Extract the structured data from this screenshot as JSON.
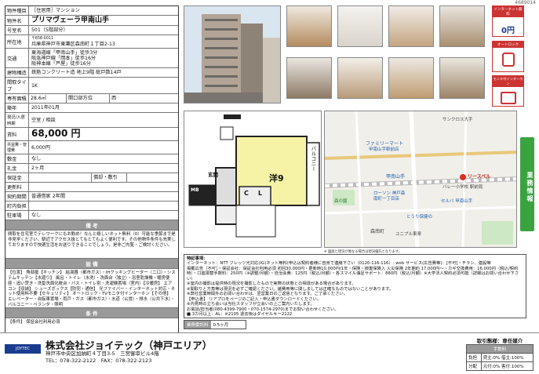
{
  "doc_id": "4689014",
  "property": {
    "rows": {
      "type_label": "物件種目",
      "type_value": "［住居用］マンション",
      "name_label": "物件名",
      "name_value": "プリマヴェーラ甲南山手",
      "room_label": "号室名",
      "room_value": "501（5階部分）",
      "addr_label": "所在地",
      "postal": "〒658-0011",
      "addr_value": "兵庫県神戸市東灘区森南町１丁目2-13",
      "traffic_label": "交通",
      "traffic_1": "東海道線「甲南山手」徒歩3分",
      "traffic_2": "阪急神戸線「岡本」徒歩16分",
      "traffic_3": "阪神本線「芦屋」徒歩16分",
      "structure_label": "建物構造",
      "structure_value": "鉄筋コンクリート造 地上9階 総戸数14戸",
      "layout_label": "間取タイプ",
      "layout_value": "1K",
      "area_label": "専有面積",
      "area_value": "28.6㎡",
      "opening_label": "開口部方位",
      "opening_value": "西",
      "built_label": "築年",
      "built_value": "2011年01月",
      "vacancy_label": "現況/入居時期",
      "vacancy_value": "空室 / 相談",
      "rent_label": "賃料",
      "rent_value": "68,000 円",
      "fee_label": "共益費・管理費",
      "fee_value": "6,000円",
      "deposit_label": "敷金",
      "deposit_value": "なし",
      "key_label": "礼金",
      "key_value": "2ヶ月",
      "guarantee_label": "保証金",
      "guarantee_value": "",
      "amort_label": "償却・敷引",
      "amort_value": "",
      "renewal_label": "更新料",
      "renewal_value": "",
      "contract_label": "契約期間",
      "contract_value": "普通借家 2年間",
      "parking_label": "町内負担",
      "parking_value": "",
      "lot_label": "駐車場",
      "lot_value": "なし"
    },
    "notes_title": "備 考",
    "notes_text": "間取を住宅室でテレワークにもお勧め！なんと嬉しいネット無料（0）可能な季節まで是非見学ください。駅近でアクセス抜とてもとてもよく便利です。その他物件条件も充実しておりますので快適生活をお送りできることでしょう。是非ご内覧・ご検討ください。",
    "equip_title": "設 備",
    "equip_text": "【位置】 角部屋【キッチン】 給湯器（都市ガス）・IHクッキングヒーター（二口）・システムキッチン【水廻り】 風呂・トイレ（水洗）・洗面台（独立）・浴室乾燥機・暖房便座・追い焚き・洗髪洗面化粧台・バス・トイレ別・洗濯機置場（室内）【冷暖房】 エアコン【収納】 シューズボックス【防犯・通信】 光ファイバー・インターネット対応・ネット使用料不要【セキュリティ】 オートロック・TVモニタ付インターホン【その他】 エレベーター・自転車置場・雨戸・ガス（都市ガス）・水道（公営）・排水（公共下水）・バルコニー・ペランダ・照明",
    "cond_title": "条 件",
    "cond_text": "【条件】 保証会社利用必須"
  },
  "icons": {
    "net_label": "インターネット無料",
    "net_value": "0円",
    "lock_label": "オートロック",
    "monitor_label": "モニタ付インターホン"
  },
  "side_tab": "業務情報",
  "plan": {
    "room_label": "洋9",
    "balcony": "バルコニー",
    "entrance": "玄関",
    "ms": "MB",
    "cl": "C",
    "l": "L"
  },
  "map": {
    "labels": [
      "ファミリーマート",
      "甲南山手駅前店",
      "甲南山手",
      "ローソン 神戸森",
      "南町一丁目店",
      "セルバ 甲南山手",
      "とうり保健の",
      "サンクロス大手",
      "ユニプル東楽",
      "森南町",
      "バレー小学校 駅前局",
      "森の園"
    ],
    "pin": "リースペル"
  },
  "caption": "※ 図面と現況が異なる場合は現況優先となります。",
  "remarks": {
    "title": "特記事項：",
    "lines": [
      "インターネット：NTT フレッツ光対応(IG)ネット無料(申込は契約者様に自身で連絡下さい（0120-116-116）- web サービス(広告費等)：[不可]・チラシ、建設等",
      "掲載広告［不可］・保証会社：保証会社利用必須 初回30,000円・更新時10,000円/1年・保険・損害保険入 火災保険 2年期約 17,000円～・カギ交換費用：16,000円（税込/契約時）・口座振替手数料：250円（※調整/月額）・自治会費：125円（税込/月額）・各スマイル満足サポート：880円（税込/月額）※大学法人契約必須可能（詳細はお問い合わせ下さい）",
      "※室内の撮影は提供時の現況を撮影したもので実際の状態との相違がある場合があります。",
      "※間取りと方角等は現況を必ずご確認ください。諸費用等に関しましては正確なものではないことがあります。",
      "※弊社営業時間外のお問い合わせは、翌営業日のご返信となります。ご了承ください。",
      "【申込書】 リアプロをページのご記入・申込書ダウンロードください。",
      "※内見時の立ち会いは当社スタッフが立会いの上ご案内いたします。",
      "お電話/担当者(080-4399-7900・070-1574-2970)までお問い合わせください。",
      "■ 3カ月以上：AL：※2105 退去後はダイヤルキー2122"
    ]
  },
  "foot_tag": "業務委託料",
  "foot_val": "0.5ヶ月",
  "company": {
    "logo": "JOYTEC",
    "name": "株式会社ジョイテック（神戸エリア）",
    "addr": "神戸市中央区加納町４丁目3-5　三宮御幸ビル4階",
    "tel": "TEL：078-322-2122　FAX：078-322-2123"
  },
  "transaction": {
    "head": "取引態様：専任媒介",
    "sub": "手数料",
    "r1_label": "負担",
    "r1_value": "貸主:0% 借主:100%",
    "r2_label": "分配",
    "r2_value": "元付:0% 客付:100%"
  }
}
